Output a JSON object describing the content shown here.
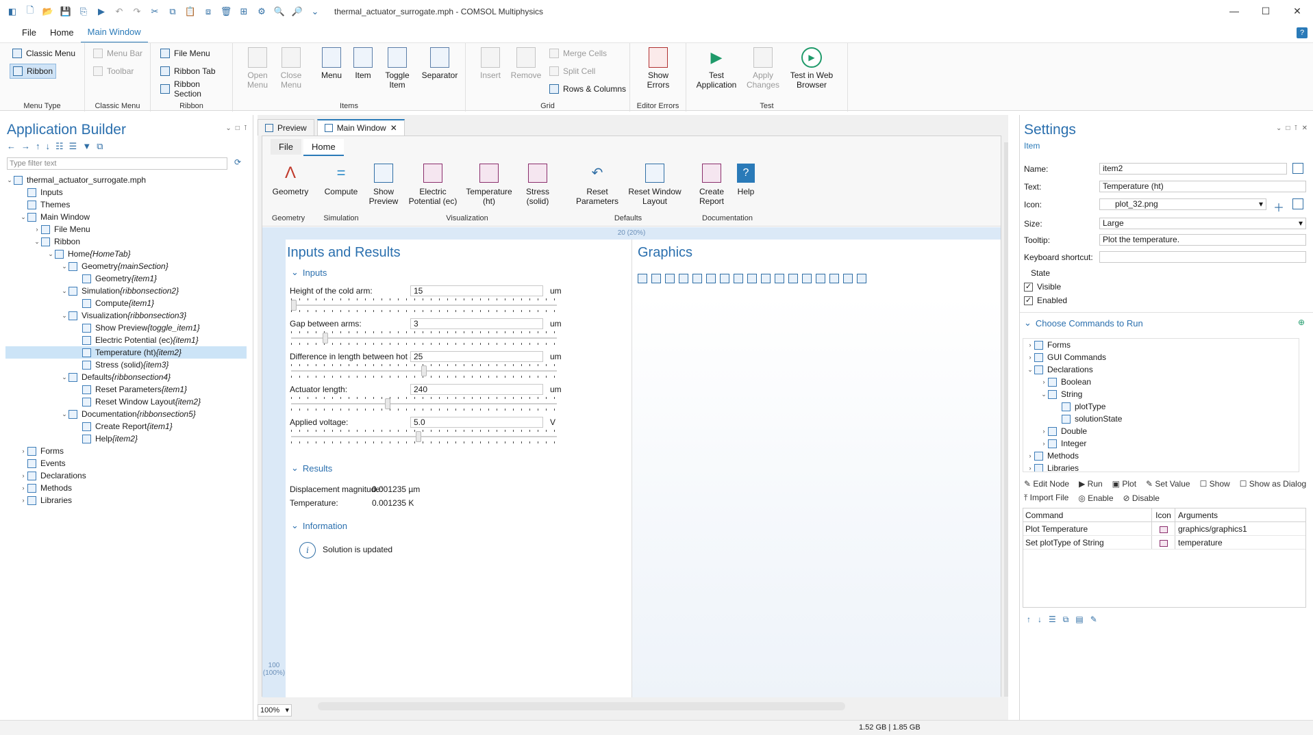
{
  "window": {
    "title": "thermal_actuator_surrogate.mph - COMSOL Multiphysics",
    "min": "—",
    "max": "☐",
    "close": "✕"
  },
  "menu": {
    "file": "File",
    "home": "Home",
    "main_window": "Main Window",
    "help": "?"
  },
  "ribbon": {
    "classic_menu": "Classic Menu",
    "ribbon_btn": "Ribbon",
    "group_menu_type": "Menu Type",
    "menu_bar": "Menu Bar",
    "toolbar": "Toolbar",
    "group_classic_menu": "Classic Menu",
    "file_menu": "File Menu",
    "ribbon_tab": "Ribbon Tab",
    "ribbon_section": "Ribbon Section",
    "group_ribbon": "Ribbon",
    "open_menu": "Open\nMenu",
    "close_menu": "Close\nMenu",
    "menu": "Menu",
    "item": "Item",
    "toggle_item": "Toggle\nItem",
    "separator": "Separator",
    "group_items": "Items",
    "insert": "Insert",
    "remove": "Remove",
    "merge_cells": "Merge Cells",
    "split_cell": "Split Cell",
    "rows_columns": "Rows & Columns",
    "group_grid": "Grid",
    "show_errors": "Show\nErrors",
    "group_editor_errors": "Editor Errors",
    "test_application": "Test\nApplication",
    "apply_changes": "Apply\nChanges",
    "test_web": "Test in Web\nBrowser",
    "group_test": "Test"
  },
  "app_builder": {
    "title": "Application Builder",
    "filter_placeholder": "Type filter text",
    "tree": [
      {
        "d": 0,
        "arrow": "⌄",
        "label": "thermal_actuator_surrogate.mph",
        "tag": ""
      },
      {
        "d": 1,
        "arrow": "",
        "label": "Inputs",
        "tag": ""
      },
      {
        "d": 1,
        "arrow": "",
        "label": "Themes",
        "tag": ""
      },
      {
        "d": 1,
        "arrow": "⌄",
        "label": "Main Window",
        "tag": ""
      },
      {
        "d": 2,
        "arrow": "›",
        "label": "File Menu",
        "tag": ""
      },
      {
        "d": 2,
        "arrow": "⌄",
        "label": "Ribbon",
        "tag": ""
      },
      {
        "d": 3,
        "arrow": "⌄",
        "label": "Home ",
        "tag": "{HomeTab}"
      },
      {
        "d": 4,
        "arrow": "⌄",
        "label": "Geometry ",
        "tag": "{mainSection}"
      },
      {
        "d": 5,
        "arrow": "",
        "label": "Geometry ",
        "tag": "{item1}"
      },
      {
        "d": 4,
        "arrow": "⌄",
        "label": "Simulation ",
        "tag": "{ribbonsection2}"
      },
      {
        "d": 5,
        "arrow": "",
        "label": "Compute ",
        "tag": "{item1}"
      },
      {
        "d": 4,
        "arrow": "⌄",
        "label": "Visualization ",
        "tag": "{ribbonsection3}"
      },
      {
        "d": 5,
        "arrow": "",
        "label": "Show Preview ",
        "tag": "{toggle_item1}"
      },
      {
        "d": 5,
        "arrow": "",
        "label": "Electric Potential (ec) ",
        "tag": "{item1}"
      },
      {
        "d": 5,
        "arrow": "",
        "label": "Temperature (ht) ",
        "tag": "{item2}",
        "sel": true
      },
      {
        "d": 5,
        "arrow": "",
        "label": "Stress (solid) ",
        "tag": "{item3}"
      },
      {
        "d": 4,
        "arrow": "⌄",
        "label": "Defaults ",
        "tag": "{ribbonsection4}"
      },
      {
        "d": 5,
        "arrow": "",
        "label": "Reset Parameters ",
        "tag": "{item1}"
      },
      {
        "d": 5,
        "arrow": "",
        "label": "Reset Window Layout ",
        "tag": "{item2}"
      },
      {
        "d": 4,
        "arrow": "⌄",
        "label": "Documentation ",
        "tag": "{ribbonsection5}"
      },
      {
        "d": 5,
        "arrow": "",
        "label": "Create Report ",
        "tag": "{item1}"
      },
      {
        "d": 5,
        "arrow": "",
        "label": "Help ",
        "tag": "{item2}"
      },
      {
        "d": 1,
        "arrow": "›",
        "label": "Forms",
        "tag": ""
      },
      {
        "d": 1,
        "arrow": "",
        "label": "Events",
        "tag": ""
      },
      {
        "d": 1,
        "arrow": "›",
        "label": "Declarations",
        "tag": ""
      },
      {
        "d": 1,
        "arrow": "›",
        "label": "Methods",
        "tag": ""
      },
      {
        "d": 1,
        "arrow": "›",
        "label": "Libraries",
        "tag": ""
      }
    ]
  },
  "editor": {
    "tab_preview": "Preview",
    "tab_main": "Main Window",
    "app_file": "File",
    "app_home": "Home",
    "geometry": "Geometry",
    "compute": "Compute",
    "show_preview": "Show\nPreview",
    "electric": "Electric\nPotential (ec)",
    "temperature": "Temperature\n(ht)",
    "stress": "Stress\n(solid)",
    "reset_params": "Reset\nParameters",
    "reset_layout": "Reset Window\nLayout",
    "create_report": "Create\nReport",
    "help": "Help",
    "g_geometry": "Geometry",
    "g_simulation": "Simulation",
    "g_visualization": "Visualization",
    "g_defaults": "Defaults",
    "g_documentation": "Documentation",
    "ruler_top": "20 (20%)",
    "ruler_left": "100\n(100%)",
    "form_title": "Inputs and Results",
    "inputs_header": "Inputs",
    "fields": [
      {
        "label": "Height of the cold arm:",
        "value": "15",
        "unit": "um",
        "thumb": 0.0
      },
      {
        "label": "Gap between arms:",
        "value": "3",
        "unit": "um",
        "thumb": 0.12
      },
      {
        "label": "Difference in length between hot arms:",
        "value": "25",
        "unit": "um",
        "thumb": 0.5
      },
      {
        "label": "Actuator length:",
        "value": "240",
        "unit": "um",
        "thumb": 0.36
      },
      {
        "label": "Applied voltage:",
        "value": "5.0",
        "unit": "V",
        "thumb": 0.48
      }
    ],
    "results_header": "Results",
    "disp_label": "Displacement magnitude:",
    "disp_value": "0.001235 µm",
    "temp_label": "Temperature:",
    "temp_value": "0.001235 K",
    "info_header": "Information",
    "info_text": "Solution is updated",
    "graphics_title": "Graphics",
    "zoom": "100%"
  },
  "settings": {
    "title": "Settings",
    "subtitle": "Item",
    "name_label": "Name:",
    "name_value": "item2",
    "text_label": "Text:",
    "text_value": "Temperature (ht)",
    "icon_label": "Icon:",
    "icon_value": "plot_32.png",
    "size_label": "Size:",
    "size_value": "Large",
    "tooltip_label": "Tooltip:",
    "tooltip_value": "Plot the temperature.",
    "shortcut_label": "Keyboard shortcut:",
    "shortcut_value": "",
    "state_label": "State",
    "visible": "Visible",
    "enabled": "Enabled",
    "commands_header": "Choose Commands to Run",
    "ctree": [
      {
        "d": 0,
        "arrow": "›",
        "label": "Forms"
      },
      {
        "d": 0,
        "arrow": "›",
        "label": "GUI Commands"
      },
      {
        "d": 0,
        "arrow": "⌄",
        "label": "Declarations"
      },
      {
        "d": 1,
        "arrow": "›",
        "label": "Boolean"
      },
      {
        "d": 1,
        "arrow": "⌄",
        "label": "String"
      },
      {
        "d": 2,
        "arrow": "",
        "label": "plotType"
      },
      {
        "d": 2,
        "arrow": "",
        "label": "solutionState"
      },
      {
        "d": 1,
        "arrow": "›",
        "label": "Double"
      },
      {
        "d": 1,
        "arrow": "›",
        "label": "Integer"
      },
      {
        "d": 0,
        "arrow": "›",
        "label": "Methods"
      },
      {
        "d": 0,
        "arrow": "›",
        "label": "Libraries"
      }
    ],
    "edit_node": "Edit Node",
    "run": "Run",
    "plot": "Plot",
    "set_value": "Set Value",
    "show": "Show",
    "show_dialog": "Show as Dialog",
    "import_file": "Import File",
    "enable": "Enable",
    "disable": "Disable",
    "col_command": "Command",
    "col_icon": "Icon",
    "col_args": "Arguments",
    "rows": [
      {
        "cmd": "Plot Temperature",
        "args": "graphics/graphics1"
      },
      {
        "cmd": "Set plotType of String",
        "args": "temperature"
      }
    ]
  },
  "status": {
    "memory": "1.52 GB | 1.85 GB"
  }
}
